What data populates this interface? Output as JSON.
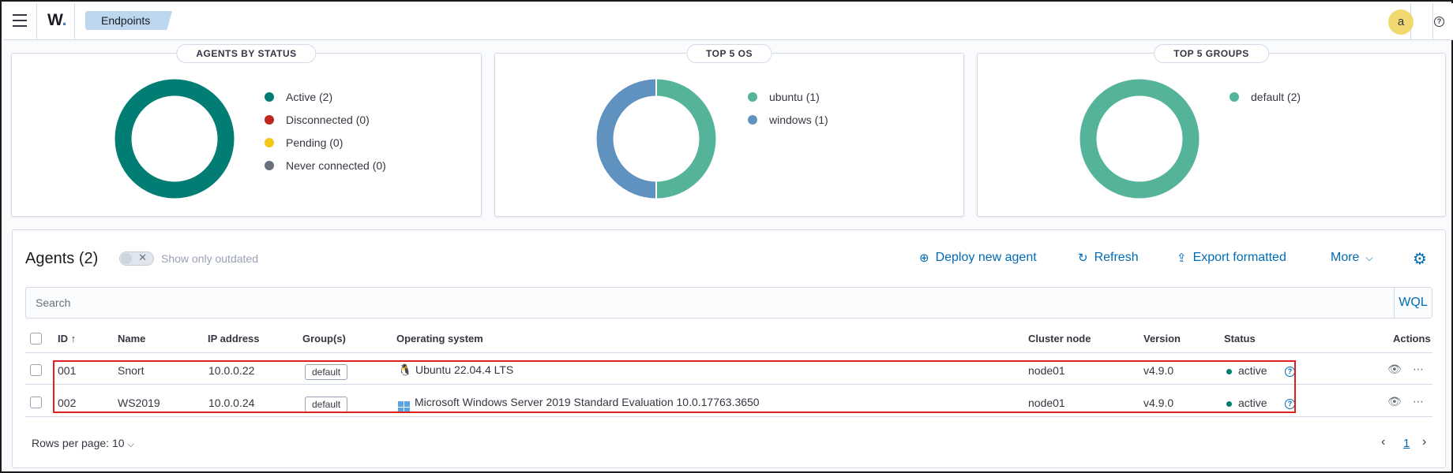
{
  "header": {
    "logo_text": "W",
    "logo_dot": ".",
    "breadcrumb": "Endpoints",
    "user_initial": "a",
    "help_glyph": "?"
  },
  "panels": {
    "status": {
      "title": "AGENTS BY STATUS",
      "legend": [
        {
          "label": "Active (2)",
          "color": "#017d73",
          "value": 2
        },
        {
          "label": "Disconnected (0)",
          "color": "#bd271e",
          "value": 0
        },
        {
          "label": "Pending (0)",
          "color": "#f5c518",
          "value": 0
        },
        {
          "label": "Never connected (0)",
          "color": "#69707d",
          "value": 0
        }
      ]
    },
    "os": {
      "title": "TOP 5 OS",
      "legend": [
        {
          "label": "ubuntu (1)",
          "color": "#54b399",
          "value": 1
        },
        {
          "label": "windows (1)",
          "color": "#6092c0",
          "value": 1
        }
      ]
    },
    "groups": {
      "title": "TOP 5 GROUPS",
      "legend": [
        {
          "label": "default (2)",
          "color": "#54b399",
          "value": 2
        }
      ]
    }
  },
  "agents": {
    "title": "Agents (2)",
    "toggle_label": "Show only outdated",
    "toggle_x": "✕",
    "actions": {
      "deploy": "Deploy new agent",
      "refresh": "Refresh",
      "export": "Export formatted",
      "more": "More"
    },
    "search_placeholder": "Search",
    "wql": "WQL",
    "columns": {
      "id": "ID",
      "name": "Name",
      "ip": "IP address",
      "groups": "Group(s)",
      "os": "Operating system",
      "cluster": "Cluster node",
      "version": "Version",
      "status": "Status",
      "actions": "Actions"
    },
    "rows": [
      {
        "id": "001",
        "name": "Snort",
        "ip": "10.0.0.22",
        "group": "default",
        "os": "Ubuntu 22.04.4 LTS",
        "os_icon": "linux-icon",
        "cluster": "node01",
        "version": "v4.9.0",
        "status": "active"
      },
      {
        "id": "002",
        "name": "WS2019",
        "ip": "10.0.0.24",
        "group": "default",
        "os": "Microsoft Windows Server 2019 Standard Evaluation 10.0.17763.3650",
        "os_icon": "windows-icon",
        "cluster": "node01",
        "version": "v4.9.0",
        "status": "active"
      }
    ],
    "rows_per_page": "Rows per page: 10",
    "current_page": "1"
  }
}
